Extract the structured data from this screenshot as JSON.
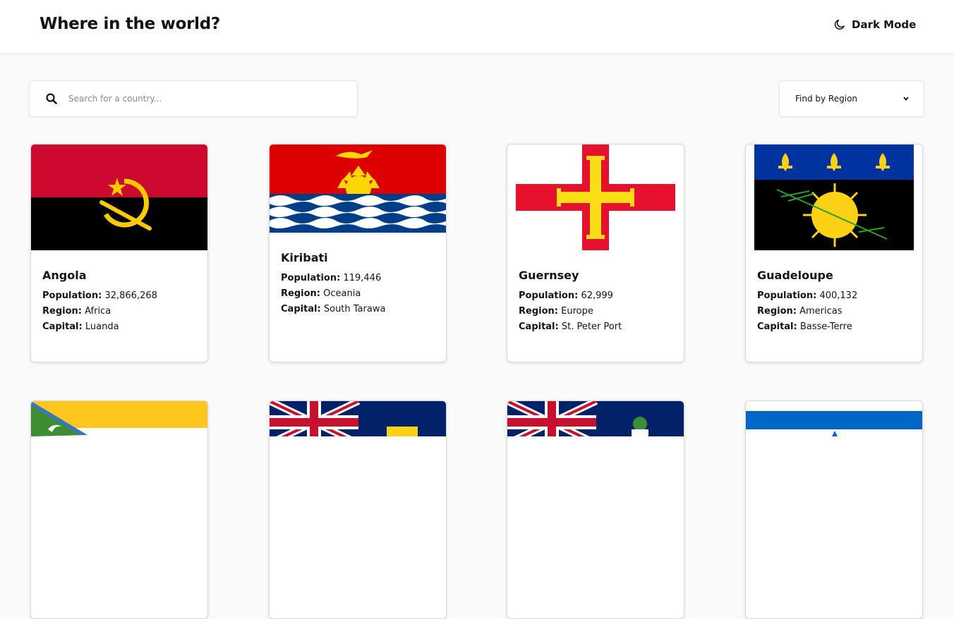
{
  "header": {
    "title": "Where in the world?",
    "dark_mode_label": "Dark Mode"
  },
  "search": {
    "placeholder": "Search for a country..."
  },
  "filter": {
    "label": "Find by Region"
  },
  "labels": {
    "population": "Population:",
    "region": "Region:",
    "capital": "Capital:"
  },
  "countries": [
    {
      "name": "Angola",
      "population": "32,866,268",
      "region": "Africa",
      "capital": "Luanda"
    },
    {
      "name": "Kiribati",
      "population": "119,446",
      "region": "Oceania",
      "capital": "South Tarawa"
    },
    {
      "name": "Guernsey",
      "population": "62,999",
      "region": "Europe",
      "capital": "St. Peter Port"
    },
    {
      "name": "Guadeloupe",
      "population": "400,132",
      "region": "Americas",
      "capital": "Basse-Terre"
    }
  ],
  "icons": {
    "search": "search-icon",
    "theme": "moon-icon",
    "dropdown": "chevron-down-icon"
  }
}
